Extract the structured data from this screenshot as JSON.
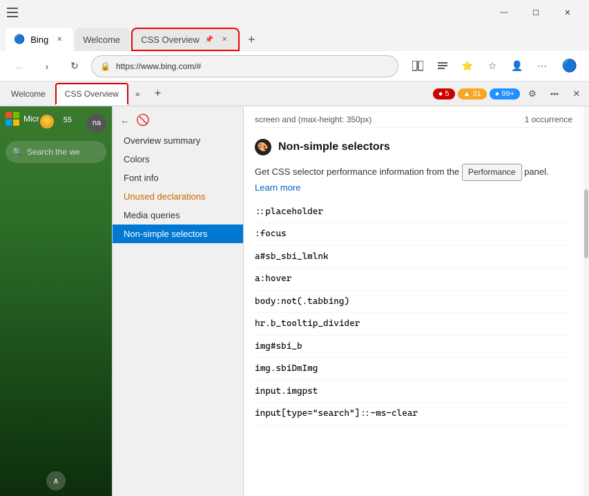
{
  "titlebar": {
    "title": "Bing",
    "minimize": "—",
    "maximize": "☐",
    "close": "✕",
    "tab_icon": "🔵"
  },
  "tabs": [
    {
      "id": "bing",
      "label": "Bing",
      "active": false,
      "favicon": "bing"
    },
    {
      "id": "welcome",
      "label": "Welcome",
      "active": false
    },
    {
      "id": "css-overview",
      "label": "CSS Overview",
      "active": true
    }
  ],
  "address_bar": {
    "url": "https://www.bing.com/#",
    "lock_icon": "🔒"
  },
  "toolbar": {
    "back": "←",
    "forward": "→",
    "refresh": "↻",
    "add_tab": "+",
    "more_tabs": "⋯"
  },
  "devtools_tabs": [
    {
      "id": "welcome",
      "label": "Welcome"
    },
    {
      "id": "css-overview",
      "label": "CSS Overview",
      "active": true
    }
  ],
  "devtools_badges": {
    "errors": "5",
    "warnings": "31",
    "info": "99+"
  },
  "css_nav": {
    "items": [
      {
        "id": "overview-summary",
        "label": "Overview summary",
        "active": false,
        "warning": false
      },
      {
        "id": "colors",
        "label": "Colors",
        "active": false,
        "warning": false
      },
      {
        "id": "font-info",
        "label": "Font info",
        "active": false,
        "warning": false
      },
      {
        "id": "unused-declarations",
        "label": "Unused declarations",
        "active": false,
        "warning": true
      },
      {
        "id": "media-queries",
        "label": "Media queries",
        "active": false,
        "warning": false
      },
      {
        "id": "non-simple-selectors",
        "label": "Non-simple selectors",
        "active": true,
        "warning": false
      }
    ]
  },
  "main_panel": {
    "prev_text": "screen and (max-height: 350px)",
    "prev_occurrence": "1 occurrence",
    "section_title": "Non-simple selectors",
    "section_icon": "🎨",
    "description_prefix": "Get CSS selector performance information from the",
    "performance_button": "Performance",
    "description_suffix": "panel.",
    "learn_more": "Learn more",
    "selectors": [
      "::placeholder",
      ":focus",
      "a#sb_sbi_lmlnk",
      "a:hover",
      "body:not(.tabbing)",
      "hr.b_tooltip_divider",
      "img#sbi_b",
      "img.sbiDmImg",
      "input.imgpst",
      "input[type=\"search\"]::-ms-clear"
    ]
  },
  "bing_sidebar": {
    "logo_text": "Micr",
    "search_placeholder": "Search the we",
    "points": "55",
    "avatar_text": "na..."
  }
}
